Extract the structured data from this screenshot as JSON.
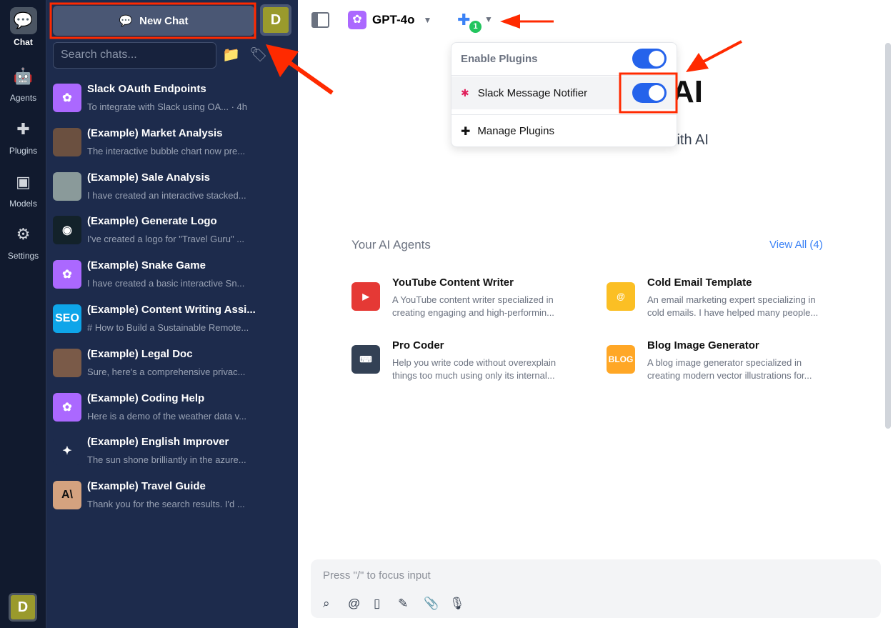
{
  "rail": {
    "items": [
      {
        "label": "Chat",
        "icon": "chat-bubble-icon"
      },
      {
        "label": "Agents",
        "icon": "robot-icon"
      },
      {
        "label": "Plugins",
        "icon": "puzzle-icon"
      },
      {
        "label": "Models",
        "icon": "chip-icon"
      },
      {
        "label": "Settings",
        "icon": "gear-icon"
      }
    ],
    "avatar": "D"
  },
  "sidebar": {
    "new_chat": "New Chat",
    "avatar": "D",
    "search_placeholder": "Search chats...",
    "chats": [
      {
        "title": "Slack OAuth Endpoints",
        "snippet": "To integrate with Slack using OA... · 4h",
        "avatar": "openai",
        "color": "#ab68ff"
      },
      {
        "title": "(Example) Market Analysis",
        "snippet": "The interactive bubble chart now pre...",
        "avatar": "photo",
        "color": "#6b5040"
      },
      {
        "title": "(Example) Sale Analysis",
        "snippet": "I have created an interactive stacked...",
        "avatar": "photo",
        "color": "#8a9a9a"
      },
      {
        "title": "(Example) Generate Logo",
        "snippet": "I've created a logo for \"Travel Guru\" ...",
        "avatar": "logo",
        "color": "#13222a"
      },
      {
        "title": "(Example) Snake Game",
        "snippet": "I have created a basic interactive Sn...",
        "avatar": "openai",
        "color": "#ab68ff"
      },
      {
        "title": "(Example) Content Writing Assi...",
        "snippet": "# How to Build a Sustainable Remote...",
        "avatar": "SEO",
        "color": "#0ea5e9"
      },
      {
        "title": "(Example) Legal Doc",
        "snippet": "Sure, here's a comprehensive privac...",
        "avatar": "photo",
        "color": "#7a5a48"
      },
      {
        "title": "(Example) Coding Help",
        "snippet": "Here is a demo of the weather data v...",
        "avatar": "openai",
        "color": "#ab68ff"
      },
      {
        "title": "(Example) English Improver",
        "snippet": "The sun shone brilliantly in the azure...",
        "avatar": "gemini",
        "color": "#1d2b4c"
      },
      {
        "title": "(Example) Travel Guide",
        "snippet": "Thank you for the search results. I'd ...",
        "avatar": "A\\",
        "color": "#d4a27f"
      }
    ]
  },
  "topbar": {
    "model": "GPT-4o",
    "plugin_count": "1"
  },
  "plugins_menu": {
    "enable_label": "Enable Plugins",
    "enable_on": true,
    "plugin": "Slack Message Notifier",
    "plugin_on": true,
    "manage": "Manage Plugins"
  },
  "main": {
    "title_fragment": "AI",
    "subtitle_fragment": "with AI",
    "agents_heading": "Your AI Agents",
    "view_all": "View All (4)",
    "agents": [
      {
        "name": "YouTube Content Writer",
        "desc": "A YouTube content writer specialized in creating engaging and high-performin...",
        "color": "#e53935"
      },
      {
        "name": "Cold Email Template",
        "desc": "An email marketing expert specializing in cold emails. I have helped many people...",
        "color": "#fbbf24"
      },
      {
        "name": "Pro Coder",
        "desc": "Help you write code without overexplain things too much using only its internal...",
        "color": "#334155"
      },
      {
        "name": "Blog Image Generator",
        "desc": "A blog image generator specialized in creating modern vector illustrations for...",
        "color": "#ffa726"
      }
    ]
  },
  "composer": {
    "placeholder": "Press \"/\" to focus input"
  },
  "colors": {
    "accent": "#2563eb",
    "sidebar": "#1d2b4c",
    "annotation": "#ff2a00"
  }
}
